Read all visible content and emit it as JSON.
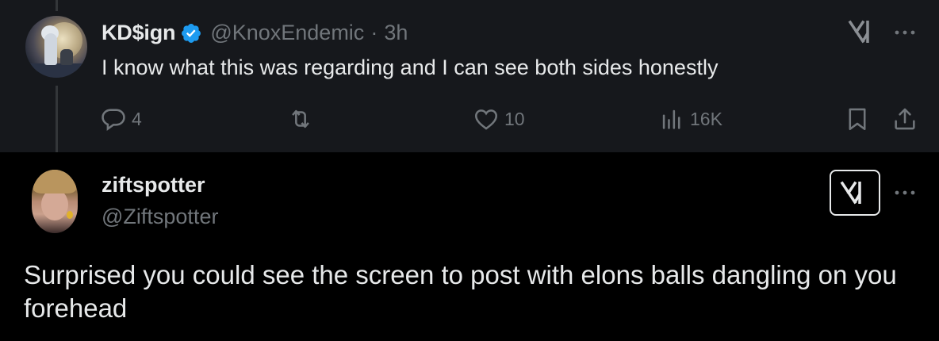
{
  "parent_tweet": {
    "author_name": "KD$ign",
    "author_handle": "@KnoxEndemic",
    "separator": "·",
    "time": "3h",
    "text": "I know what this was regarding and I can see both sides honestly",
    "replies": "4",
    "retweets": "",
    "likes": "10",
    "views": "16K",
    "icons": [
      "reply-icon",
      "retweet-icon",
      "like-icon",
      "views-icon",
      "bookmark-icon",
      "share-icon",
      "grok-icon",
      "more-icon",
      "verified-badge-icon"
    ]
  },
  "reply_tweet": {
    "author_name": "ziftspotter",
    "author_handle": "@Ziftspotter",
    "text": "Surprised you could see the screen to post with elons balls dangling on you forehead",
    "icons": [
      "grok-icon",
      "more-icon"
    ]
  },
  "colors": {
    "background": "#000000",
    "parent_background": "#16181c",
    "primary_text": "#e7e9ea",
    "secondary_text": "#71767b",
    "verified_blue": "#1d9bf0"
  }
}
